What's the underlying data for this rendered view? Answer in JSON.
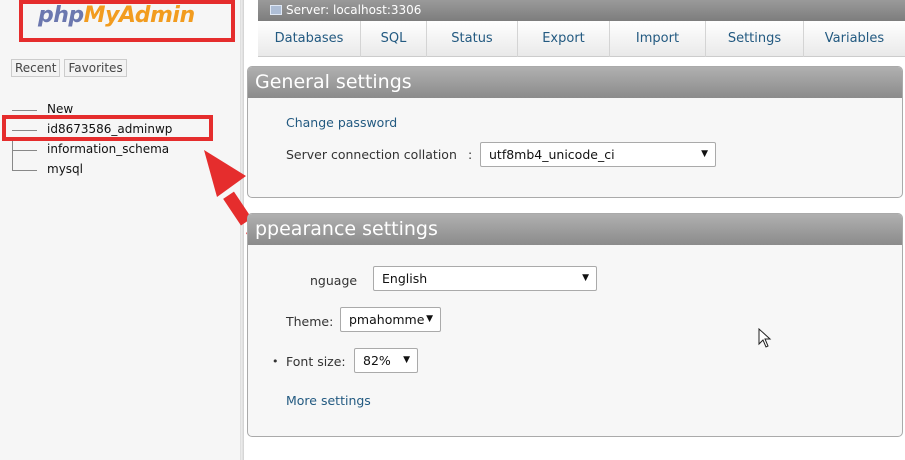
{
  "logo": {
    "part1": "php",
    "part2": "MyAdmin"
  },
  "nav": {
    "tabs": [
      "Recent",
      "Favorites"
    ],
    "tree": [
      "New",
      "id8673586_adminwp",
      "information_schema",
      "mysql"
    ]
  },
  "server_bar": {
    "label": "Server: localhost:3306"
  },
  "menu": [
    "Databases",
    "SQL",
    "Status",
    "Export",
    "Import",
    "Settings",
    "Variables"
  ],
  "general_settings": {
    "title": "General settings",
    "change_password": "Change password",
    "collation_label": "Server connection collation",
    "collation_separator": ":",
    "collation_value": "utf8mb4_unicode_ci"
  },
  "appearance_settings": {
    "title": "ppearance settings",
    "language_label": "nguage",
    "language_value": "English",
    "theme_label": "Theme:",
    "theme_value": "pmahomme",
    "font_size_label": "Font size:",
    "font_size_value": "82%",
    "more_settings": "More settings"
  },
  "colors": {
    "highlight": "#e52d2d",
    "link": "#235a81",
    "accent_orange": "#f29c1f",
    "accent_blue": "#6c78af"
  },
  "icons": {
    "caret": "▼",
    "server": "server-icon"
  }
}
